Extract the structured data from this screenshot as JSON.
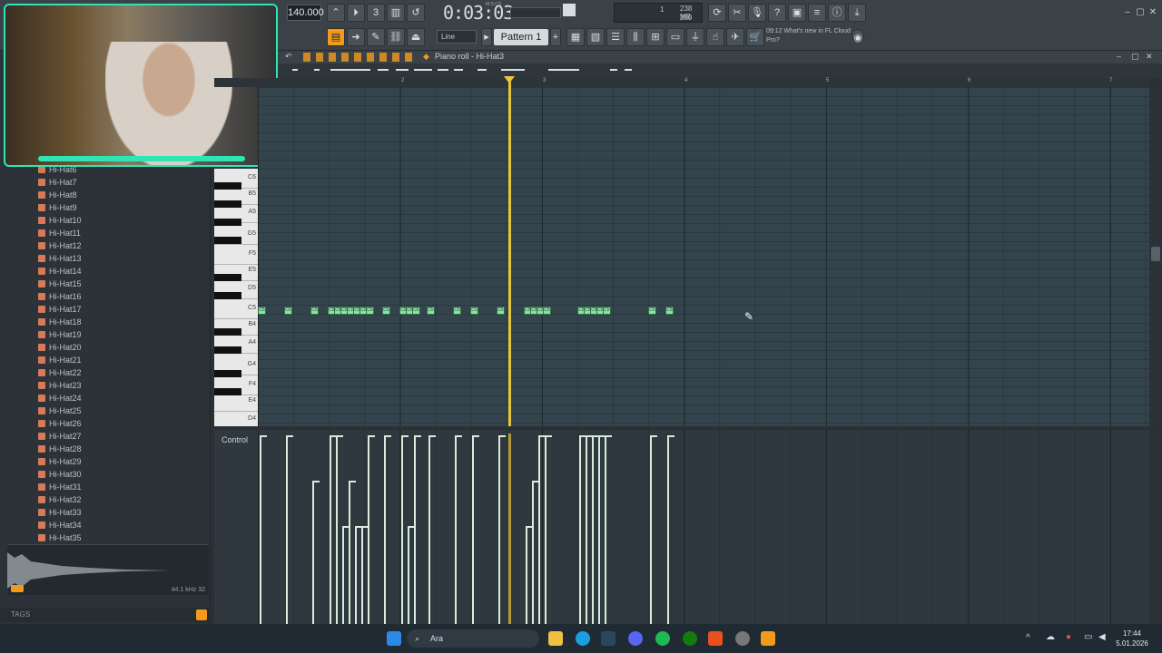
{
  "toolbar": {
    "tempo": "140.000",
    "time": "0:03:03",
    "time_unit": "M:S:CS",
    "cpu_value": "1",
    "memory": "238 MB",
    "polyphony": "280",
    "snap": "Line",
    "pattern": "Pattern 1",
    "news_time": "09:12",
    "news_text": "What's new in FL Cloud Pro?"
  },
  "piano_roll": {
    "title": "Piano roll - Hi-Hat3",
    "ruler": [
      "2",
      "3",
      "4",
      "5",
      "6",
      "7"
    ],
    "keys": [
      "C6",
      "B5",
      "A5",
      "G5",
      "F5",
      "E5",
      "D5",
      "C5",
      "B4",
      "A4",
      "G4",
      "F4",
      "E4",
      "D4"
    ],
    "note_label": "C5",
    "control_label": "Control"
  },
  "browser": {
    "items": [
      "Hi-Hat6",
      "Hi-Hat7",
      "Hi-Hat8",
      "Hi-Hat9",
      "Hi-Hat10",
      "Hi-Hat11",
      "Hi-Hat12",
      "Hi-Hat13",
      "Hi-Hat14",
      "Hi-Hat15",
      "Hi-Hat16",
      "Hi-Hat17",
      "Hi-Hat18",
      "Hi-Hat19",
      "Hi-Hat20",
      "Hi-Hat21",
      "Hi-Hat22",
      "Hi-Hat23",
      "Hi-Hat24",
      "Hi-Hat25",
      "Hi-Hat26",
      "Hi-Hat27",
      "Hi-Hat28",
      "Hi-Hat29",
      "Hi-Hat30",
      "Hi-Hat31",
      "Hi-Hat32",
      "Hi-Hat33",
      "Hi-Hat34",
      "Hi-Hat35"
    ],
    "sample_info": "44.1 kHz 32",
    "tags_label": "TAGS"
  },
  "taskbar": {
    "search_placeholder": "Ara",
    "time": "17:44",
    "date": "5.01.2026"
  },
  "colors": {
    "accent": "#f39a1b",
    "note": "#8fe0a8",
    "playhead": "#e7c53a",
    "webcam_border": "#2ee6b5"
  }
}
